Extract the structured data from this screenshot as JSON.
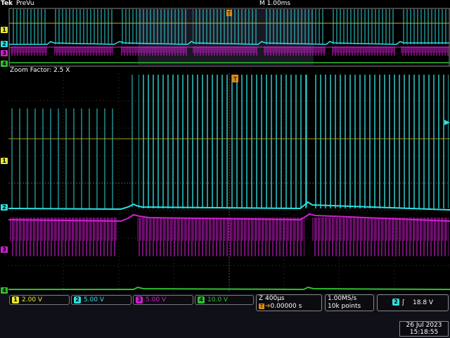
{
  "header": {
    "brand": "Tek",
    "mode": "PreVu",
    "timebase": "M 1.00ms"
  },
  "zoom": {
    "label": "Zoom Factor: 2.5 X"
  },
  "channels": [
    {
      "num": "1",
      "scale": "2.00 V",
      "color": "#e8e832"
    },
    {
      "num": "2",
      "scale": "5.00 V",
      "color": "#2fe0e0"
    },
    {
      "num": "3",
      "scale": "5.00 V",
      "color": "#d020d0"
    },
    {
      "num": "4",
      "scale": "10.0 V",
      "color": "#30c030"
    }
  ],
  "zoom_info": {
    "zoom_scale": "Z 400µs",
    "trigger_pos": "0.00000 s"
  },
  "acquisition": {
    "sample_rate": "1.00MS/s",
    "record_length": "10k points"
  },
  "trigger": {
    "source": "2",
    "slope_icon": "rising-edge-icon",
    "level": "18.8 V"
  },
  "datetime": {
    "date": "26 Jul  2023",
    "time": "15:18:55"
  },
  "markers": {
    "trigger_glyph": "T"
  }
}
